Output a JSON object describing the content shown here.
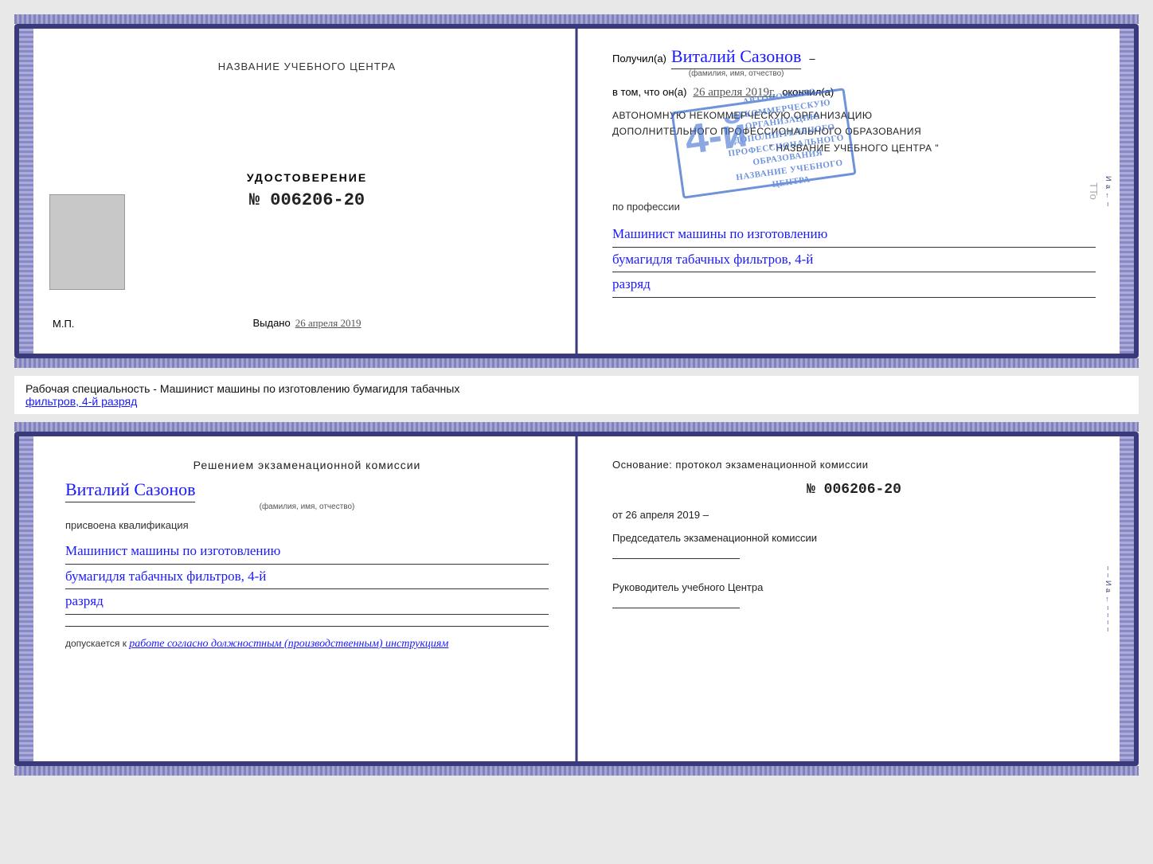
{
  "top_doc": {
    "left": {
      "title": "НАЗВАНИЕ УЧЕБНОГО ЦЕНТРА",
      "cert_label": "УДОСТОВЕРЕНИЕ",
      "cert_number": "№ 006206-20",
      "issued_prefix": "Выдано",
      "issued_date": "26 апреля 2019",
      "mp_label": "М.П."
    },
    "right": {
      "received_prefix": "Получил(а)",
      "fullname": "Виталий Сазонов",
      "name_sublabel": "(фамилия, имя, отчество)",
      "in_that_prefix": "в том, что он(а)",
      "in_that_date": "26 апреля 2019г.",
      "finished_label": "окончил(а)",
      "org_line1": "АВТОНОМНУЮ НЕКОММЕРЧЕСКУЮ ОРГАНИЗАЦИЮ",
      "org_line2": "ДОПОЛНИТЕЛЬНОГО ПРОФЕССИОНАЛЬНОГО ОБРАЗОВАНИЯ",
      "org_line3": "\" НАЗВАНИЕ УЧЕБНОГО ЦЕНТРА \"",
      "profession_prefix": "по профессии",
      "profession_line1": "Машинист машины по изготовлению",
      "profession_line2": "бумагидля табачных фильтров, 4-й",
      "profession_line3": "разряд"
    },
    "stamp": {
      "big_number": "4-й",
      "line1": "АВТОНОМНУЮ НЕКОММЕРЧЕСКУЮ",
      "line2": "ОРГАНИЗАЦИЮ",
      "line3": "ДОПОЛНИТЕЛЬНОГО",
      "line4": "ПРОФЕССИОНАЛЬНОГО",
      "line5": "ОБРАЗОВАНИЯ",
      "line6": "НАЗВАНИЕ УЧЕБНОГО ЦЕНТРА"
    }
  },
  "info_bar": {
    "text_prefix": "Рабочая специальность - Машинист машины по изготовлению бумагидля табачных",
    "text_underline": "фильтров, 4-й разряд"
  },
  "bottom_doc": {
    "left": {
      "title": "Решением  экзаменационной  комиссии",
      "fullname": "Виталий Сазонов",
      "name_sublabel": "(фамилия, имя, отчество)",
      "assigned_label": "присвоена квалификация",
      "profession_line1": "Машинист машины по изготовлению",
      "profession_line2": "бумагидля табачных фильтров, 4-й",
      "profession_line3": "разряд",
      "admitted_prefix": "допускается к",
      "admitted_text": "работе согласно должностным (производственным) инструкциям"
    },
    "right": {
      "osnov_label": "Основание:  протокол  экзаменационной  комиссии",
      "number": "№  006206-20",
      "date_prefix": "от",
      "date_value": "26 апреля 2019",
      "chairman_label": "Председатель экзаменационной комиссии",
      "head_label": "Руководитель учебного Центра"
    }
  },
  "tto": "TTo"
}
